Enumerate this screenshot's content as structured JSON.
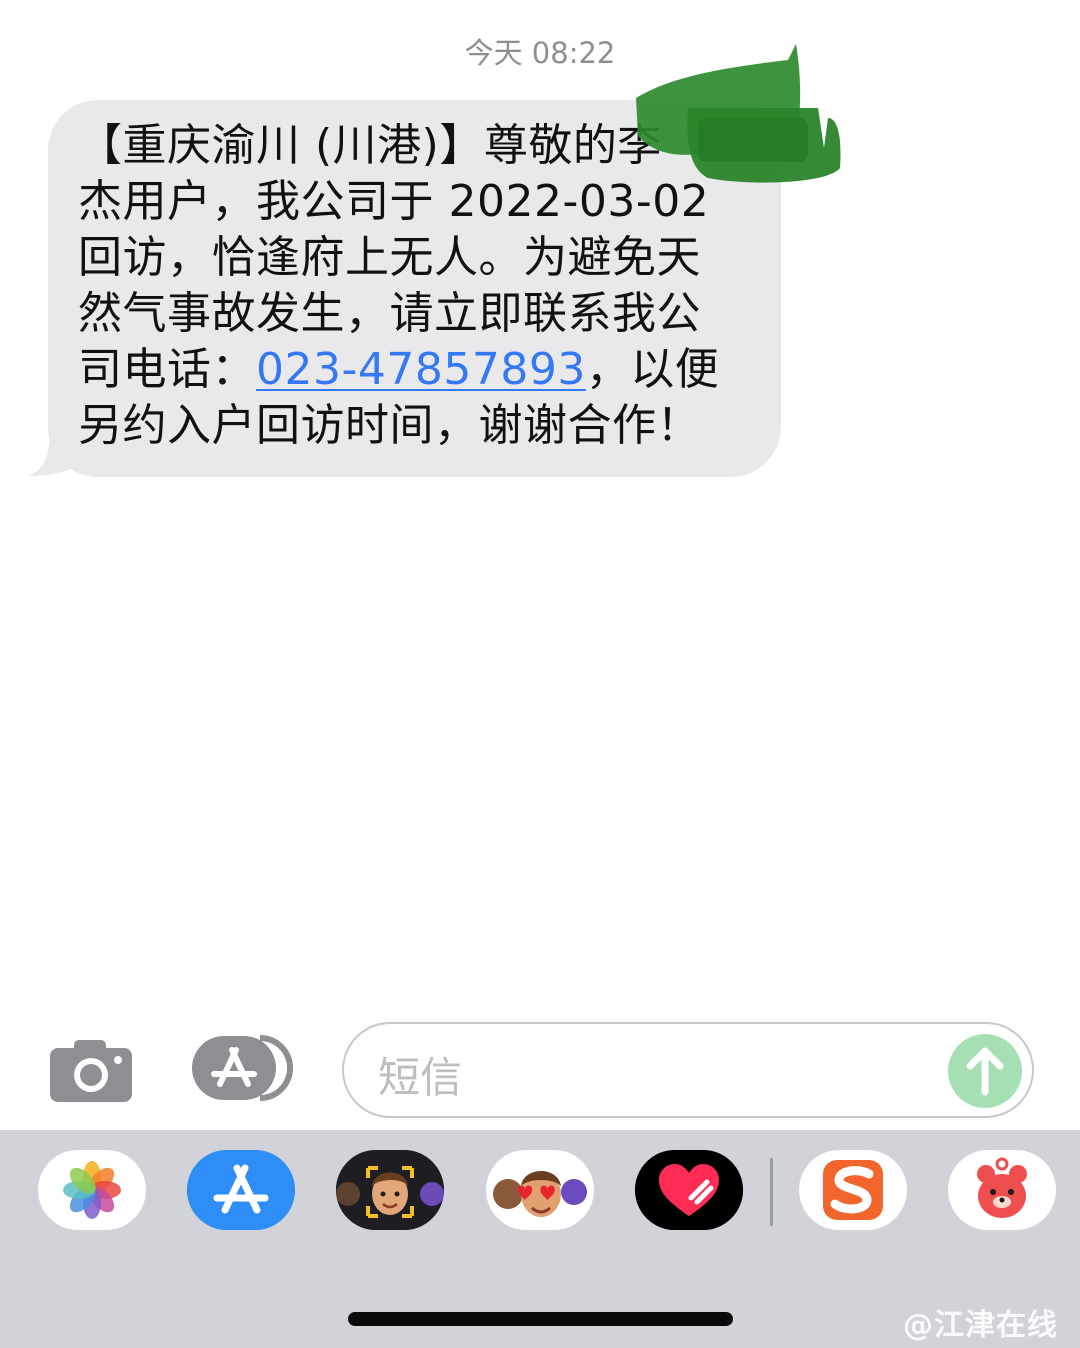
{
  "conversation": {
    "timestamp": "今天 08:22",
    "message": {
      "lines": [
        "【重庆渝川 (川港)】尊敬的李",
        "杰用户，我公司于 2022-03-02",
        "回访，恰逢府上无人。为避免天",
        "然气事故发生，请立即联系我公"
      ],
      "line5_prefix": "司电话：",
      "phone_link": "023-47857893",
      "line5_suffix": "，以便",
      "line6": "另约入户回访时间，谢谢合作！"
    }
  },
  "input_bar": {
    "camera_icon": "camera-icon",
    "apps_icon": "app-store-icon",
    "placeholder": "短信",
    "send_icon": "arrow-up-icon"
  },
  "app_tray": {
    "apps": [
      {
        "icon": "photos-icon"
      },
      {
        "icon": "app-store-icon"
      },
      {
        "icon": "memoji-icon"
      },
      {
        "icon": "memoji-stickers-icon"
      },
      {
        "icon": "digital-touch-icon"
      },
      {
        "icon": "sogou-input-icon"
      },
      {
        "icon": "bear-app-icon"
      }
    ]
  },
  "watermark": "@江津在线",
  "colors": {
    "bubble": "#e9e9eb",
    "link": "#3478f6",
    "send_button": "#a7dfb5",
    "tray": "#d1d3d9",
    "redaction": "#2e8b2e"
  }
}
